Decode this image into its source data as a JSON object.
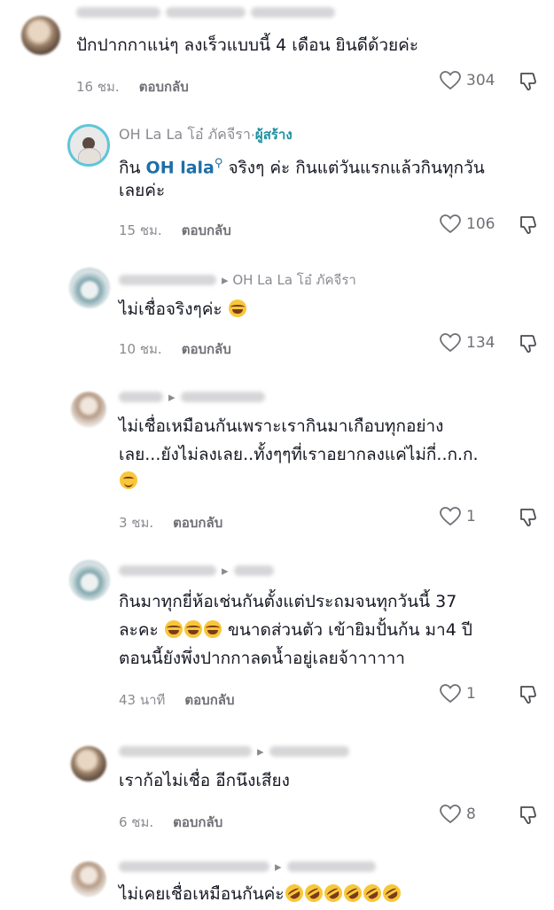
{
  "comments": [
    {
      "id": 1,
      "username": "",
      "text": "ปักปากกาแน่ๆ ลงเร็วแบบนี้ 4 เดือน ยินดีด้วยค่ะ",
      "time": "16 ชม.",
      "reply_label": "ตอบกลับ",
      "likes": "304"
    },
    {
      "id": 2,
      "creator_name": "OH La La โอ๋ ภัคจีรา",
      "creator_sep": " · ",
      "creator_tag": "ผู้สร้าง",
      "text_prefix": "กิน ",
      "mention": "OH lala",
      "text_line1_suffix": " จริงๆ ค่ะ กินแต่วันแรกแล้วกินทุกวัน",
      "text_line2": "เลยค่ะ",
      "time": "15 ชม.",
      "reply_label": "ตอบกลับ",
      "likes": "106"
    },
    {
      "id": 3,
      "reply_to": "OH La La โอ๋ ภัคจีรา",
      "text": "ไม่เชื่อจริงๆค่ะ",
      "time": "10 ชม.",
      "reply_label": "ตอบกลับ",
      "likes": "134"
    },
    {
      "id": 4,
      "text_line1": "ไม่เชื่อเหมือนกันเพราะเรากินมาเกือบทุกอย่าง",
      "text_line2": "เลย...ยังไม่ลงเลย..ทั้งๆๆที่เราอยากลงแค่ไม่กี่..ก.ก.",
      "time": "3 ชม.",
      "reply_label": "ตอบกลับ",
      "likes": "1"
    },
    {
      "id": 5,
      "text_line1": "กินมาทุกยี่ห้อเช่นกันตั้งแต่ประถมจนทุกวันนี้ 37",
      "text_line2_prefix": "ละคะ ",
      "text_line2_suffix": " ขนาดส่วนตัว เข้ายิมปั้นก้น มา4 ปี",
      "text_line3": "ตอนนี้ยังพึ่งปากกาลดน้ำอยู่เลยจ้าาาาาา",
      "time": "43 นาที",
      "reply_label": "ตอบกลับ",
      "likes": "1"
    },
    {
      "id": 6,
      "text": "เราก้อไม่เชื่อ อีกนึงเสียง",
      "time": "6 ชม.",
      "reply_label": "ตอบกลับ",
      "likes": "8"
    },
    {
      "id": 7,
      "text": "ไม่เคยเชื่อเหมือนกันค่ะ"
    }
  ],
  "icons": {
    "heart": "heart-icon",
    "dislike": "thumbs-down-icon",
    "search": "search-icon"
  },
  "colors": {
    "creator_tag": "#1d8fa0",
    "mention": "#1d6fa8",
    "meta_gray": "#8a8b91"
  }
}
